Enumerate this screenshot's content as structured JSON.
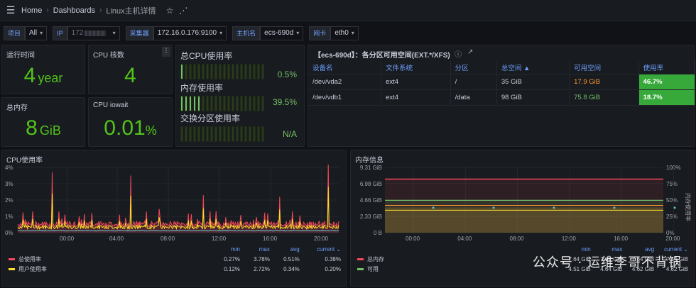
{
  "breadcrumb": [
    "Home",
    "Dashboards",
    "Linux主机详情"
  ],
  "vars": [
    {
      "label": "项目",
      "value": "All"
    },
    {
      "label": "IP",
      "value": "172"
    },
    {
      "label": "采集器",
      "value": "172.16.0.176:9100"
    },
    {
      "label": "主机名",
      "value": "ecs-690d"
    },
    {
      "label": "网卡",
      "value": "eth0"
    }
  ],
  "stats": {
    "uptime": {
      "title": "运行时间",
      "value": "4",
      "unit": "year"
    },
    "cpu_cores": {
      "title": "CPU 核数",
      "value": "4"
    },
    "total_mem": {
      "title": "总内存",
      "value": "8",
      "unit": "GiB"
    },
    "iowait": {
      "title": "CPU iowait",
      "value": "0.01",
      "unit": "%"
    }
  },
  "gauges": [
    {
      "title": "总CPU使用率",
      "value": "0.5%",
      "fill": 1
    },
    {
      "title": "内存使用率",
      "value": "39.5%",
      "fill": 5
    },
    {
      "title": "交换分区使用率",
      "value": "N/A",
      "fill": 0
    }
  ],
  "disk": {
    "title": "【ecs-690d】：各分区可用空间(EXT.*/XFS)",
    "columns": [
      "设备名",
      "文件系统",
      "分区",
      "总空间 ▲",
      "可用空间",
      "使用率"
    ],
    "rows": [
      [
        "/dev/vda2",
        "ext4",
        "/",
        "35 GiB",
        "17.9 GiB",
        "46.7%"
      ],
      [
        "/dev/vdb1",
        "ext4",
        "/data",
        "98 GiB",
        "75.8 GiB",
        "18.7%"
      ]
    ]
  },
  "cpu_chart": {
    "title": "CPU使用率",
    "y_ticks": [
      "4%",
      "3%",
      "2%",
      "1%",
      "0%"
    ],
    "x_ticks": [
      "00:00",
      "04:00",
      "08:00",
      "12:00",
      "16:00",
      "20:00"
    ],
    "legend_headers": [
      "min",
      "max",
      "avg",
      "current ⌄"
    ],
    "series": [
      {
        "name": "总使用率",
        "color": "#f2495c",
        "min": "0.27%",
        "max": "3.78%",
        "avg": "0.51%",
        "current": "0.38%"
      },
      {
        "name": "用户使用率",
        "color": "#fade2a",
        "min": "0.12%",
        "max": "2.72%",
        "avg": "0.34%",
        "current": "0.20%"
      }
    ]
  },
  "mem_chart": {
    "title": "内存信息",
    "y_ticks": [
      "9.31 GiB",
      "6.98 GiB",
      "4.66 GiB",
      "2.33 GiB",
      "0 B"
    ],
    "y2_ticks": [
      "100%",
      "75%",
      "50%",
      "25%",
      "0%"
    ],
    "y2_label": "内存使用率",
    "x_ticks": [
      "00:00",
      "04:00",
      "08:00",
      "12:00",
      "16:00",
      "20:00"
    ],
    "legend_headers": [
      "min",
      "max",
      "avg",
      "current ⌄"
    ],
    "series": [
      {
        "name": "总内存",
        "color": "#f2495c",
        "min": "7.64 GiB",
        "max": "7.64 GiB",
        "avg": "7.64 GiB",
        "current": "7.64 GiB"
      },
      {
        "name": "可用",
        "color": "#73bf69",
        "min": "4.51 GiB",
        "max": "4.64 GiB",
        "avg": "4.62 GiB",
        "current": "4.62 GiB"
      }
    ]
  },
  "watermark": "公众号 · 运维李哥不背锅"
}
